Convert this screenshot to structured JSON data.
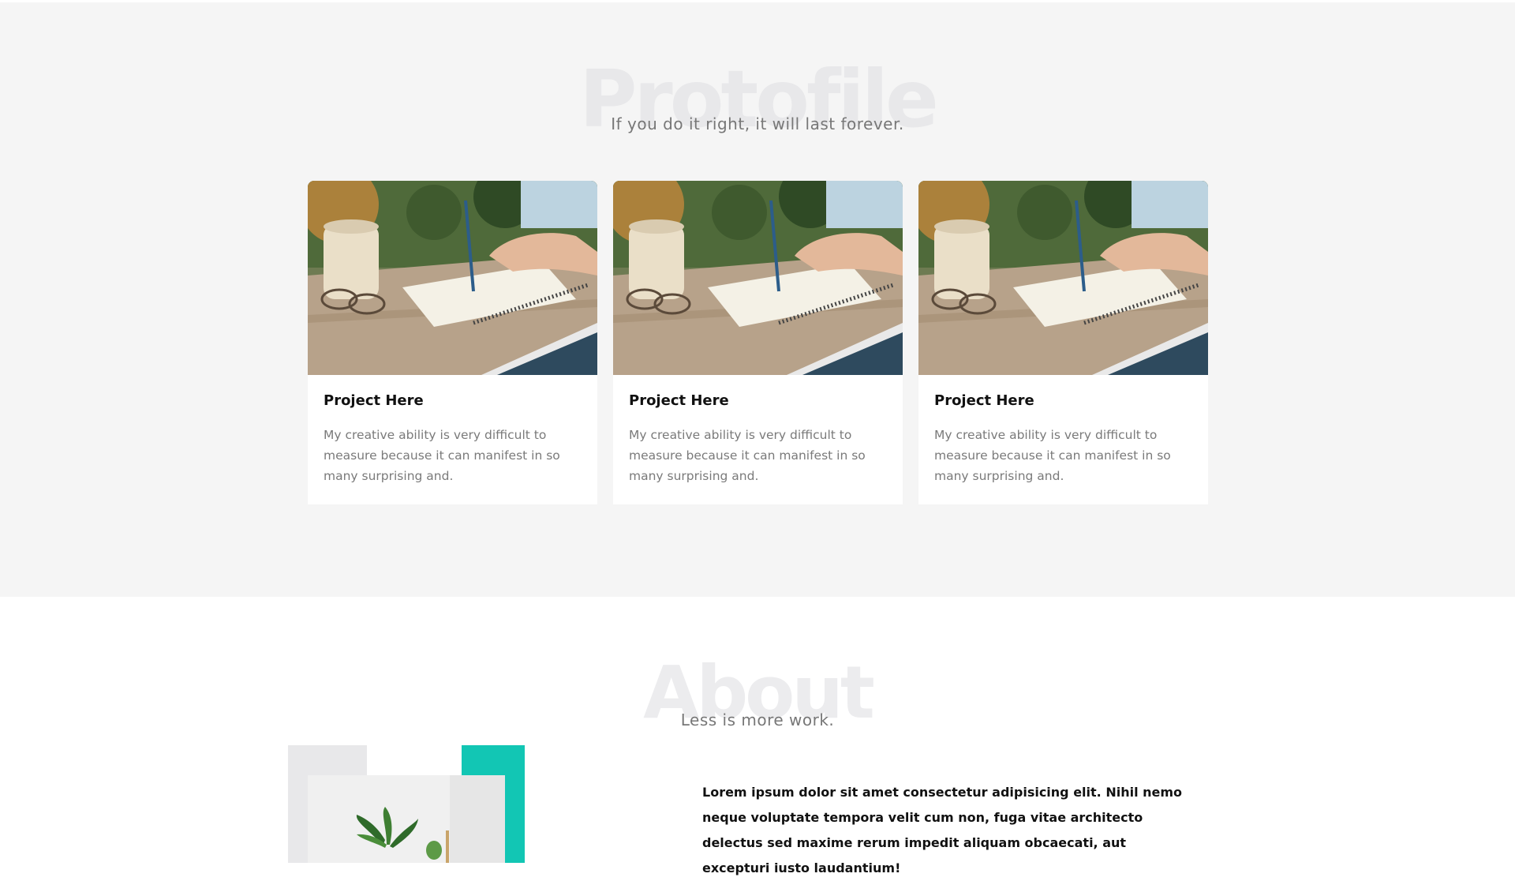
{
  "portfolio": {
    "bg_title": "Protofile",
    "subtitle": "If you do it right, it will last forever.",
    "cards": [
      {
        "title": "Project Here",
        "text": "My creative ability is very difficult to measure because it can manifest in so many surprising and."
      },
      {
        "title": "Project Here",
        "text": "My creative ability is very difficult to measure because it can manifest in so many surprising and."
      },
      {
        "title": "Project Here",
        "text": "My creative ability is very difficult to measure because it can manifest in so many surprising and."
      }
    ]
  },
  "about": {
    "bg_title": "About",
    "subtitle": "Less is more work.",
    "text": "Lorem ipsum dolor sit amet consectetur adipisicing elit. Nihil nemo neque voluptate tempora velit cum non, fuga vitae architecto delectus sed maxime rerum impedit aliquam obcaecati, aut excepturi iusto laudantium!"
  },
  "colors": {
    "accent": "#12c6b4",
    "section_bg": "#f5f5f5",
    "muted_text": "#7a7a7a"
  }
}
